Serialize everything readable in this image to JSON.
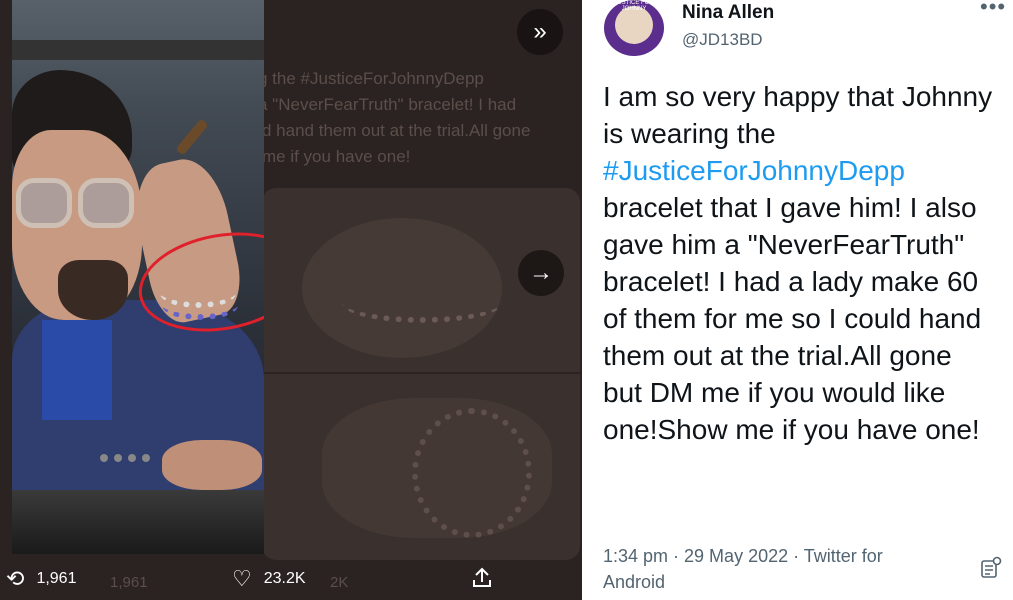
{
  "viewer": {
    "ghost_lines": [
      "g the #JusticeForJohnnyDepp",
      "a \"NeverFearTruth\" bracelet! I had",
      "d hand them out at the trial.All gone",
      "me if you have one!"
    ],
    "expand_icon": "»",
    "next_icon": "→",
    "actions": {
      "retweet_count": "1,961",
      "ghost_retweet": "1,961",
      "like_count": "23.2K",
      "ghost_like": "2K"
    }
  },
  "tweet": {
    "display_name": "Nina Allen",
    "handle": "@JD13BD",
    "avatar_text": "JUSTICE FOR JOHNNY",
    "more_icon": "•••",
    "text_before": "I am so very happy that Johnny is wearing the ",
    "hashtag": "#JusticeForJohnnyDepp",
    "text_after": " bracelet that I gave him! I also gave him a \"NeverFearTruth\" bracelet! I had a lady make 60 of them for me so I could hand them out at the trial.All gone but DM me if you would like one!Show me if you have one!",
    "meta": "1:34 pm · 29 May 2022 · Twitter for Android"
  },
  "colors": {
    "accent": "#1d9bf0",
    "viewer_bg": "#2a2321",
    "annotation": "#e0202a"
  }
}
